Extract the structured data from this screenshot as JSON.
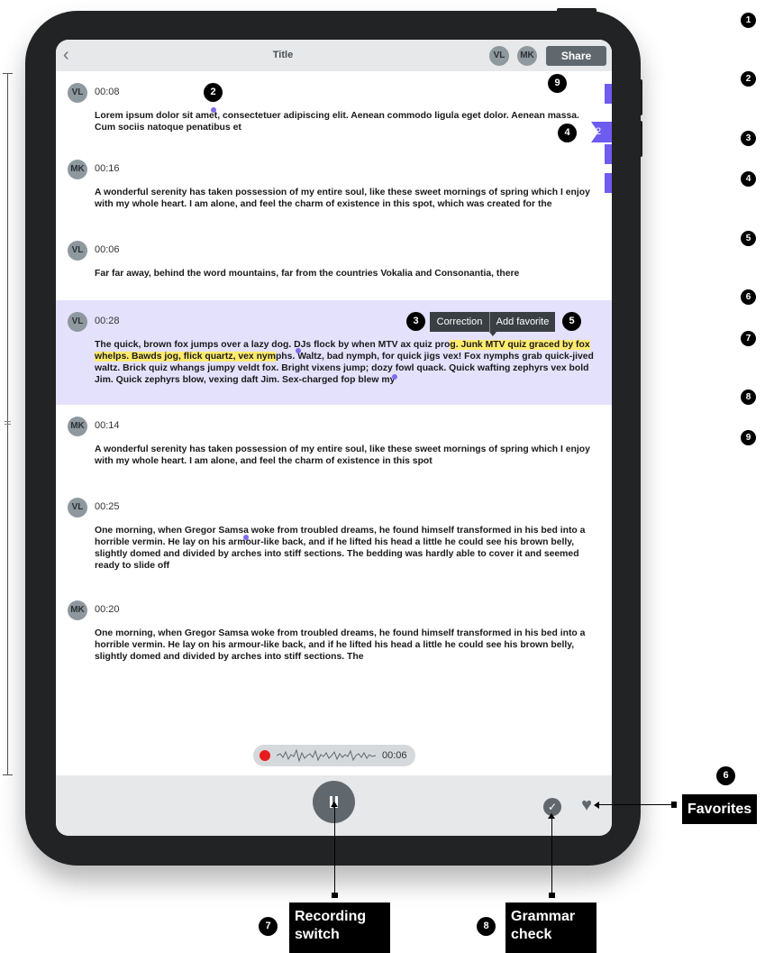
{
  "header": {
    "title": "Title",
    "share_label": "Share",
    "avatars": [
      "VL",
      "MK"
    ]
  },
  "entries": [
    {
      "speaker": "VL",
      "time": "00:08",
      "text": "Lorem ipsum dolor sit amet, consectetuer adipiscing elit. Aenean commodo ligula eget dolor. Aenean massa. Cum sociis natoque penatibus et"
    },
    {
      "speaker": "MK",
      "time": "00:16",
      "text": "A wonderful serenity has taken possession of my entire soul, like these sweet mornings of spring which I enjoy with my whole heart. I am alone, and feel the charm of existence in this spot, which was created for the"
    },
    {
      "speaker": "VL",
      "time": "00:06",
      "text": "Far far away, behind the word mountains, far from the countries Vokalia and Consonantia, there"
    },
    {
      "speaker": "VL",
      "time": "00:28",
      "text_before": "The quick, brown fox jumps over a lazy dog. DJs flock by when MTV ax quiz pro",
      "text_highlight": "g. Junk MTV quiz graced by fox whelps. Bawds jog, flick quartz, vex nym",
      "text_after": "phs. Waltz, bad nymph, for quick jigs vex! Fox nymphs grab quick-jived waltz. Brick quiz whangs jumpy veldt fox. Bright vixens jump; dozy fowl quack. Quick wafting zephyrs vex bold Jim. Quick zephyrs blow, vexing daft Jim. Sex-charged fop blew my"
    },
    {
      "speaker": "MK",
      "time": "00:14",
      "text": "A wonderful serenity has taken possession of my entire soul, like these sweet mornings of spring which I enjoy with my whole heart. I am alone, and feel the charm of existence in this spot"
    },
    {
      "speaker": "VL",
      "time": "00:25",
      "text": "One morning, when Gregor Samsa woke from troubled dreams, he found himself transformed in his bed into a horrible vermin. He lay on his armour-like back, and if he lifted his head a little he could see his brown belly, slightly domed and divided by arches into stiff sections. The bedding was hardly able to cover it and seemed ready to slide off"
    },
    {
      "speaker": "MK",
      "time": "00:20",
      "text": "One morning, when Gregor Samsa woke from troubled dreams, he found himself transformed in his bed into a horrible vermin. He lay on his armour-like back, and if he lifted his head a little he could see his brown belly, slightly domed and divided by arches into stiff sections. The"
    }
  ],
  "tooltip": {
    "correction": "Correction",
    "add_favorite": "Add favorite"
  },
  "recording": {
    "time": "00:06"
  },
  "flag_count": "2",
  "markers": {
    "m2": "2",
    "m3": "3",
    "m4": "4",
    "m5": "5",
    "m6": "6",
    "m7": "7",
    "m8": "8",
    "m9": "9"
  },
  "legend": [
    "1",
    "2",
    "3",
    "4",
    "5",
    "6",
    "7",
    "8",
    "9"
  ],
  "callouts": {
    "favorites": "Favorites",
    "recording_line1": "Recording",
    "recording_line2": "switch",
    "grammar_line1": "Grammar",
    "grammar_line2": "check"
  },
  "colors": {
    "accent": "#6e5bf0",
    "highlight": "#ffeb6e",
    "selected": "#e4e1fd",
    "record": "#e81c1c"
  }
}
